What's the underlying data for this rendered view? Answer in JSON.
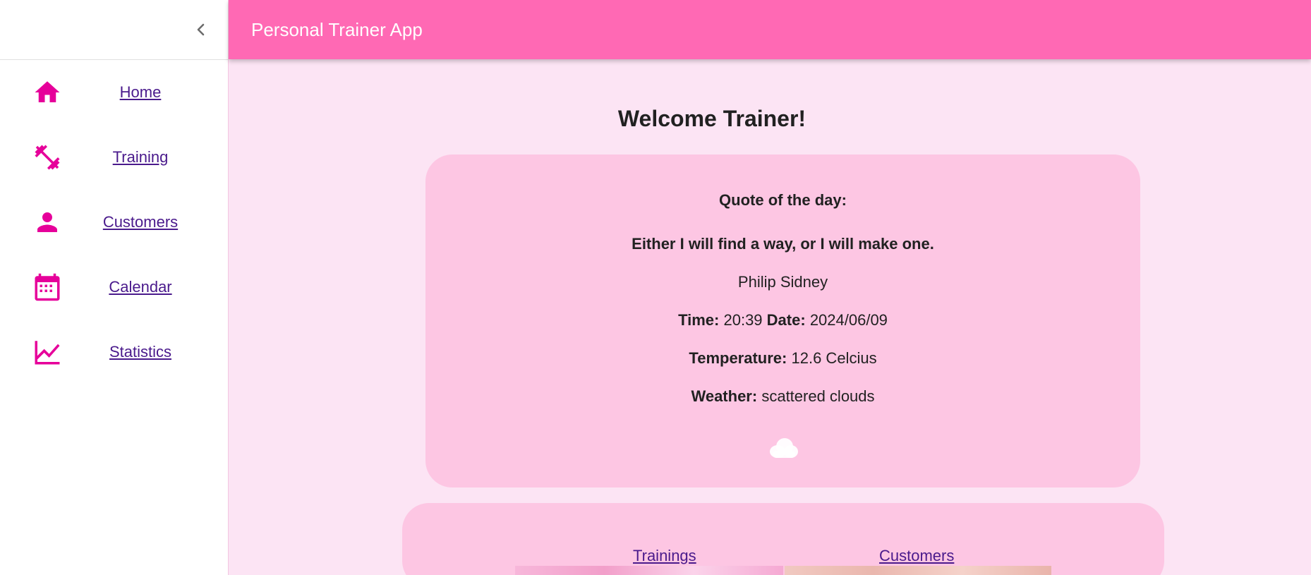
{
  "app": {
    "title": "Personal Trainer App"
  },
  "sidebar": {
    "items": [
      {
        "label": "Home",
        "icon": "home-icon"
      },
      {
        "label": "Training",
        "icon": "dumbbell-icon"
      },
      {
        "label": "Customers",
        "icon": "person-icon"
      },
      {
        "label": "Calendar",
        "icon": "calendar-icon"
      },
      {
        "label": "Statistics",
        "icon": "chart-line-icon"
      }
    ]
  },
  "main": {
    "welcome": "Welcome Trainer!",
    "quote_heading": "Quote of the day:",
    "quote_text": "Either I will find a way, or I will make one.",
    "quote_author": "Philip Sidney",
    "time_label": "Time:",
    "time_value": "20:39",
    "date_label": "Date:",
    "date_value": "2024/06/09",
    "temperature_label": "Temperature:",
    "temperature_value": "12.6 Celcius",
    "weather_label": "Weather:",
    "weather_value": "scattered clouds",
    "weather_icon": "cloud-icon",
    "links": {
      "trainings": "Trainings",
      "customers": "Customers"
    }
  },
  "colors": {
    "accent": "#ff69b4",
    "icon": "#e6009a",
    "background": "#fce4f4",
    "card": "#fdc6e3",
    "link": "#4a1a8c"
  }
}
